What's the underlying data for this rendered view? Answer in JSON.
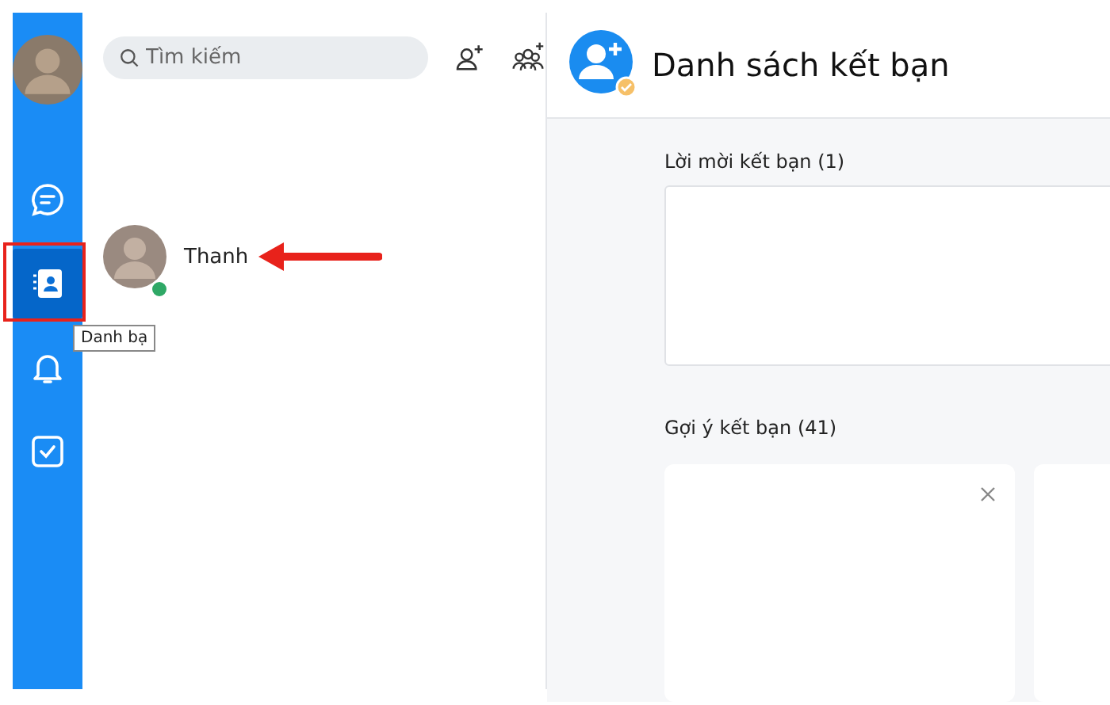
{
  "sidebar": {
    "items": [
      {
        "kind": "chat",
        "selected": false
      },
      {
        "kind": "contacts",
        "selected": true,
        "tooltip": "Danh bạ"
      },
      {
        "kind": "bell",
        "selected": false
      },
      {
        "kind": "todo",
        "selected": false
      }
    ]
  },
  "contacts_panel": {
    "search": {
      "placeholder": "Tìm kiếm"
    },
    "contacts": [
      {
        "name": "Thanh",
        "online": true
      }
    ]
  },
  "main": {
    "title": "Danh sách kết bạn",
    "sections": [
      {
        "kind": "box",
        "title": "Lời mời kết bạn (1)"
      },
      {
        "kind": "cards",
        "title": "Gợi ý kết bạn (41)"
      }
    ]
  }
}
